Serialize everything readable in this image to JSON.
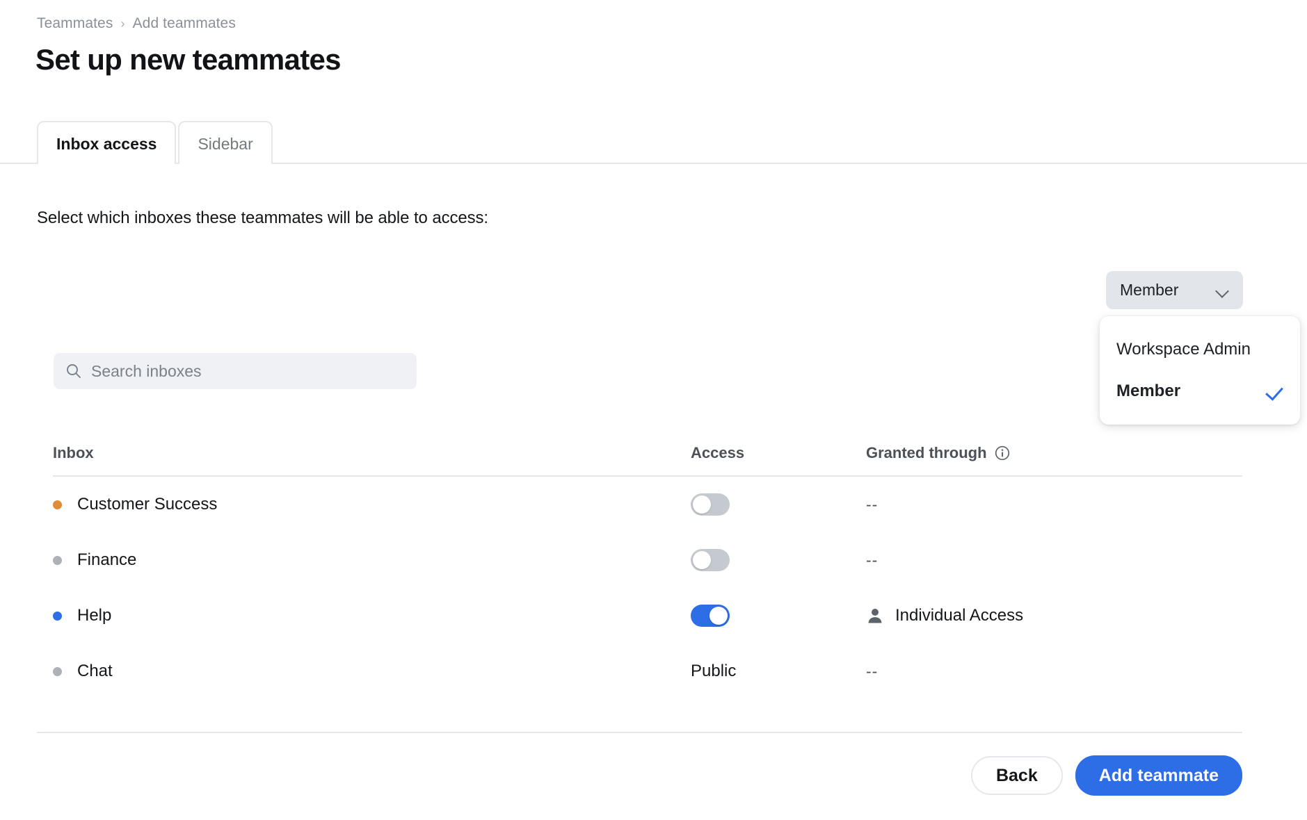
{
  "breadcrumb": {
    "items": [
      "Teammates",
      "Add teammates"
    ],
    "separator": "›"
  },
  "header": {
    "title": "Set up new teammates"
  },
  "tabs": [
    {
      "label": "Inbox access",
      "active": true
    },
    {
      "label": "Sidebar",
      "active": false
    }
  ],
  "main": {
    "instruction": "Select which inboxes these teammates will be able to access:"
  },
  "role_dropdown": {
    "selected": "Member",
    "chevron_icon": "chevron-down-icon",
    "open": true,
    "options": [
      {
        "label": "Workspace Admin",
        "selected": false
      },
      {
        "label": "Member",
        "selected": true
      }
    ],
    "check_icon": "check-icon",
    "check_color": "#2d6de5"
  },
  "search": {
    "placeholder": "Search inboxes",
    "value": "",
    "icon": "search-icon"
  },
  "table": {
    "columns": {
      "inbox": "Inbox",
      "access": "Access",
      "granted": "Granted through",
      "granted_info_icon": "info-icon"
    },
    "rows": [
      {
        "name": "Customer Success",
        "dot_color": "#e08b36",
        "access_type": "toggle",
        "access_on": false,
        "access_text": "",
        "granted": "--",
        "granted_icon": ""
      },
      {
        "name": "Finance",
        "dot_color": "#adb1b8",
        "access_type": "toggle",
        "access_on": false,
        "access_text": "",
        "granted": "--",
        "granted_icon": ""
      },
      {
        "name": "Help",
        "dot_color": "#2d6de5",
        "access_type": "toggle",
        "access_on": true,
        "access_text": "",
        "granted": "Individual Access",
        "granted_icon": "person-icon"
      },
      {
        "name": "Chat",
        "dot_color": "#adb1b8",
        "access_type": "text",
        "access_on": false,
        "access_text": "Public",
        "granted": "--",
        "granted_icon": ""
      }
    ]
  },
  "footer": {
    "back_label": "Back",
    "submit_label": "Add teammate",
    "primary_color": "#2d6de5"
  }
}
